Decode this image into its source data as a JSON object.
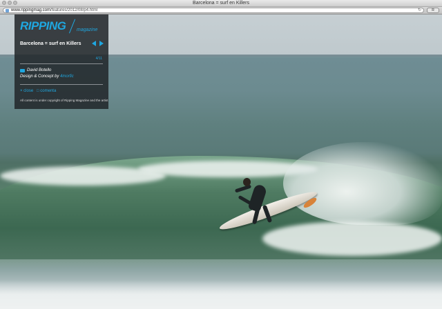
{
  "window": {
    "title": "Barcelona = surf en Killers"
  },
  "address_bar": {
    "url_domain": "www.rippingmag.com",
    "url_path": "/features/2012/08/p4.html",
    "reader_label": "R"
  },
  "magazine": {
    "logo_text": "RIPPING",
    "logo_sub": "magazine",
    "article_title": "Barcelona = surf en Killers",
    "page_count": "4/11",
    "photographer": "David Botello",
    "credit_prefix": "Design & Concept by ",
    "credit_link": "4morfic",
    "close_label": "× close",
    "comments_label": "□ comenta",
    "copyright": "All content is under copyright of Ripping Magazine and the artist"
  },
  "colors": {
    "accent": "#1fa7e0",
    "panel_bg": "#22262a"
  }
}
